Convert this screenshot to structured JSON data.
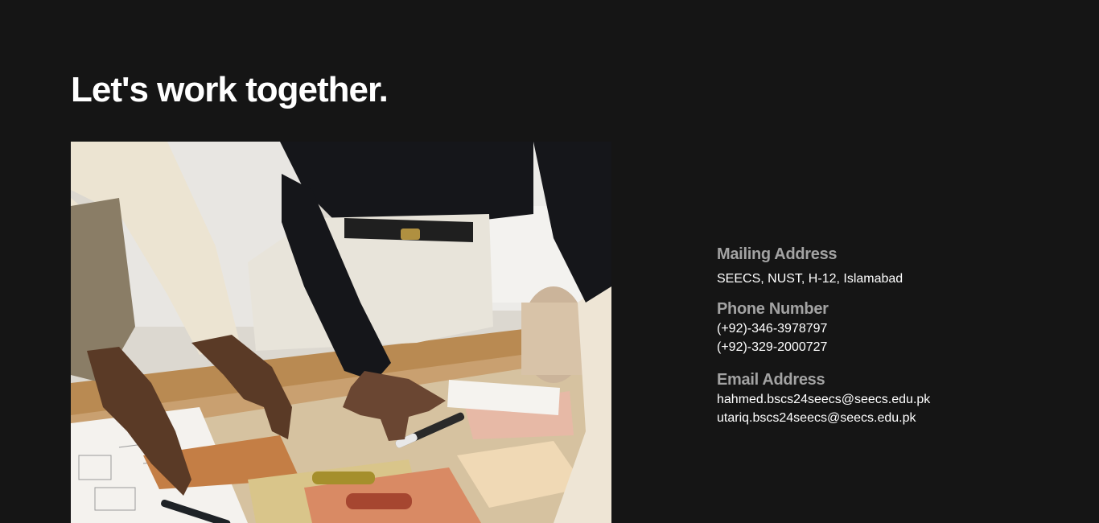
{
  "heading": "Let's work together.",
  "photo": {
    "subject": "hands-working-on-fabric-swatches-photo"
  },
  "contact": {
    "mailing": {
      "label": "Mailing Address",
      "value": "SEECS, NUST, H-12, Islamabad"
    },
    "phone": {
      "label": "Phone Number",
      "numbers": [
        "(+92)-346-3978797",
        "(+92)-329-2000727"
      ]
    },
    "email": {
      "label": "Email Address",
      "addresses": [
        "hahmed.bscs24seecs@seecs.edu.pk",
        "utariq.bscs24seecs@seecs.edu.pk"
      ]
    }
  },
  "colors": {
    "background": "#151515",
    "heading": "#ffffff",
    "label": "#a3a3a3",
    "value": "#ffffff"
  }
}
